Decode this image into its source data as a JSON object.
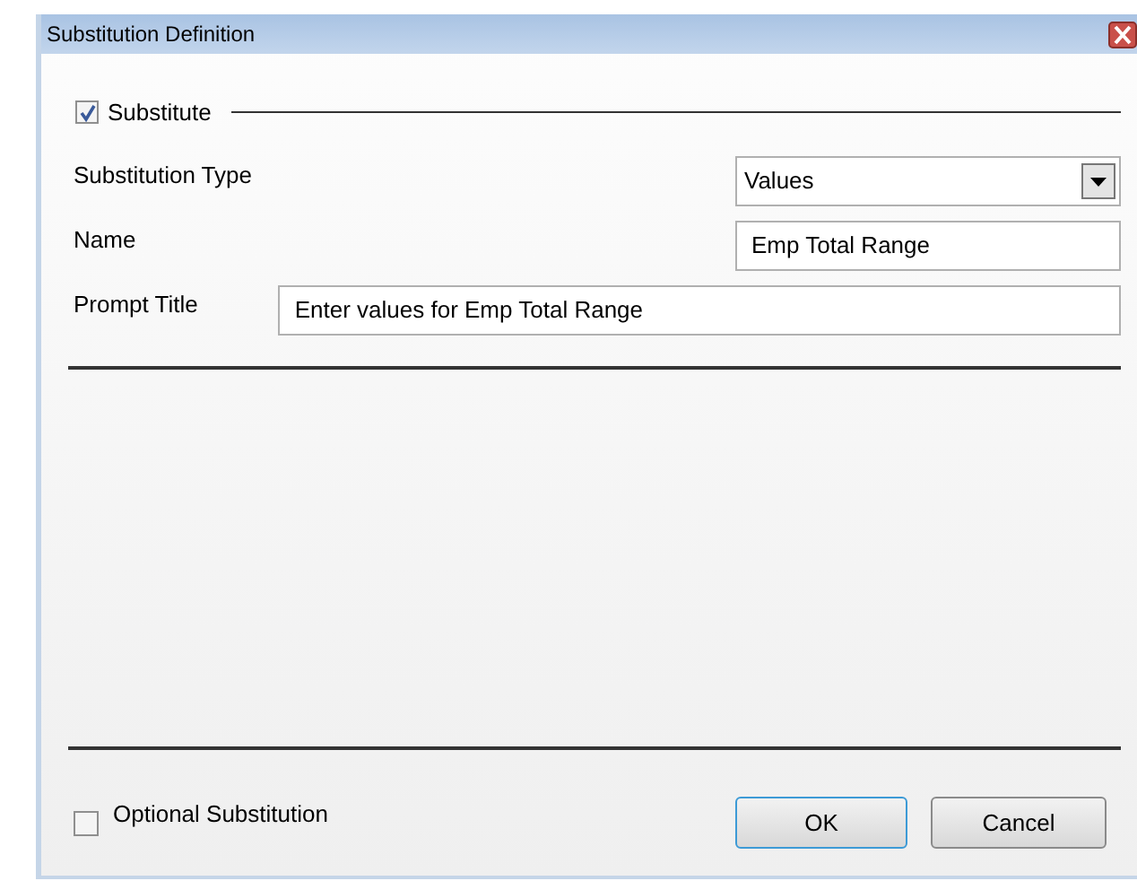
{
  "window": {
    "title": "Substitution Definition"
  },
  "substitute": {
    "label": "Substitute",
    "checked": true
  },
  "fields": [
    {
      "label": "Substitution Type",
      "kind": "dropdown",
      "value": "Values"
    },
    {
      "label": "Name",
      "kind": "text",
      "value": "Emp Total Range"
    },
    {
      "label": "Prompt Title",
      "kind": "wide",
      "value": "Enter values for Emp Total Range"
    }
  ],
  "optional": {
    "label": "Optional Substitution",
    "checked": false
  },
  "buttons": [
    {
      "label": "OK",
      "selected": true
    },
    {
      "label": "Cancel",
      "selected": false
    }
  ]
}
